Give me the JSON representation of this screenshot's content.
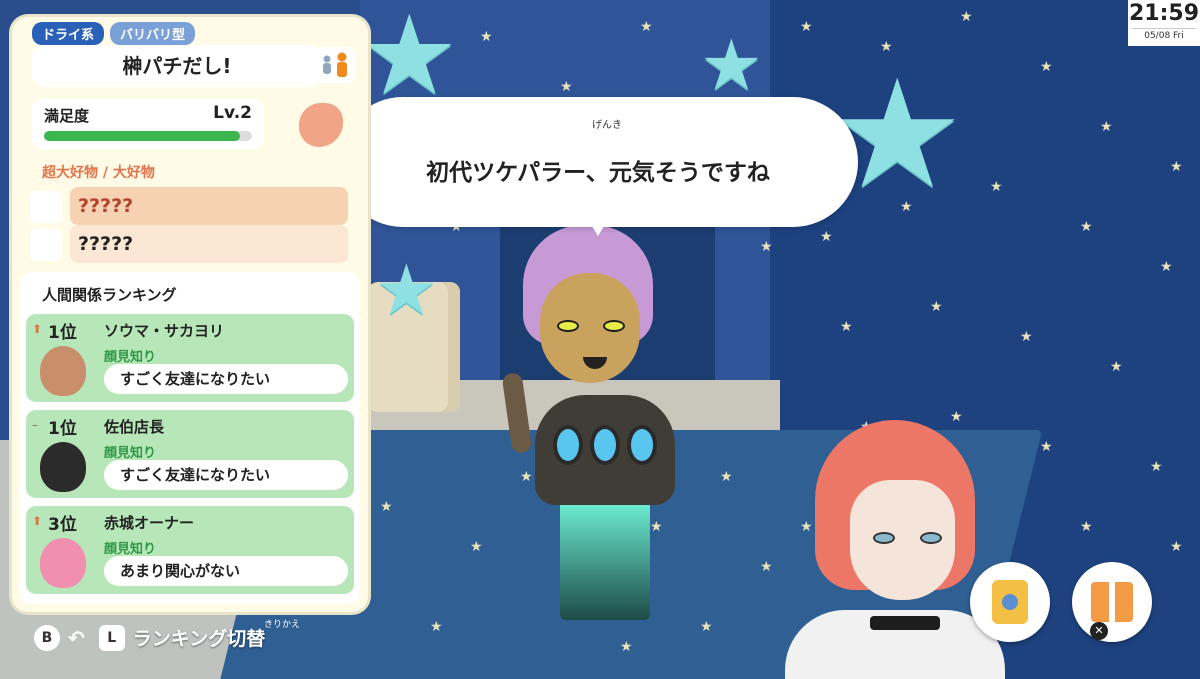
{
  "clock": {
    "time": "21:59",
    "date": "05/08 Fri"
  },
  "speech": {
    "text": "初代ツケパラー、元気そうですね",
    "ruby": "げんき"
  },
  "profile": {
    "tag_personality": "ドライ系",
    "tag_subtype": "バリバリ型",
    "name": "榊パチだし!",
    "satisfaction_label": "満足度",
    "satisfaction_level": "Lv.2",
    "satisfaction_fraction": 0.94
  },
  "favorites": {
    "heading": "超大好物 / 大好物",
    "items": [
      {
        "text": "?????",
        "color": "#b3412b",
        "bg": "#f6d2b3"
      },
      {
        "text": "?????",
        "color": "#222222",
        "bg": "#fbe7d3"
      }
    ]
  },
  "ranking": {
    "heading": "人間関係ランキング",
    "entries": [
      {
        "arrow": "up",
        "position": "1位",
        "name": "ソウマ・サカヨリ",
        "relation": "顔見知り",
        "feeling": "すごく友達になりたい",
        "face_color": "#c98e6b"
      },
      {
        "arrow": "same",
        "position": "1位",
        "name": "佐伯店長",
        "relation": "顔見知り",
        "feeling": "すごく友達になりたい",
        "face_color": "#2b2b2b"
      },
      {
        "arrow": "up",
        "position": "3位",
        "name": "赤城オーナー",
        "relation": "顔見知り",
        "feeling": "あまり関心がない",
        "face_color": "#f08fb0"
      }
    ]
  },
  "controls": {
    "b_button": "B",
    "l_button": "L",
    "l_label": "ランキング切替",
    "l_ruby": "きりかえ"
  },
  "colors": {
    "accent_blue": "#2960b8",
    "satisfaction_green": "#3cb64f",
    "rank_card_green": "#b7e7b8",
    "relation_green": "#2f9a47",
    "heading_orange": "#e2734a"
  },
  "icons": {
    "gender": "gender-icons",
    "stomach": "stomach-icon",
    "gift": "gift-icon",
    "clipboard": "clipboard-icon",
    "close": "close-icon"
  }
}
